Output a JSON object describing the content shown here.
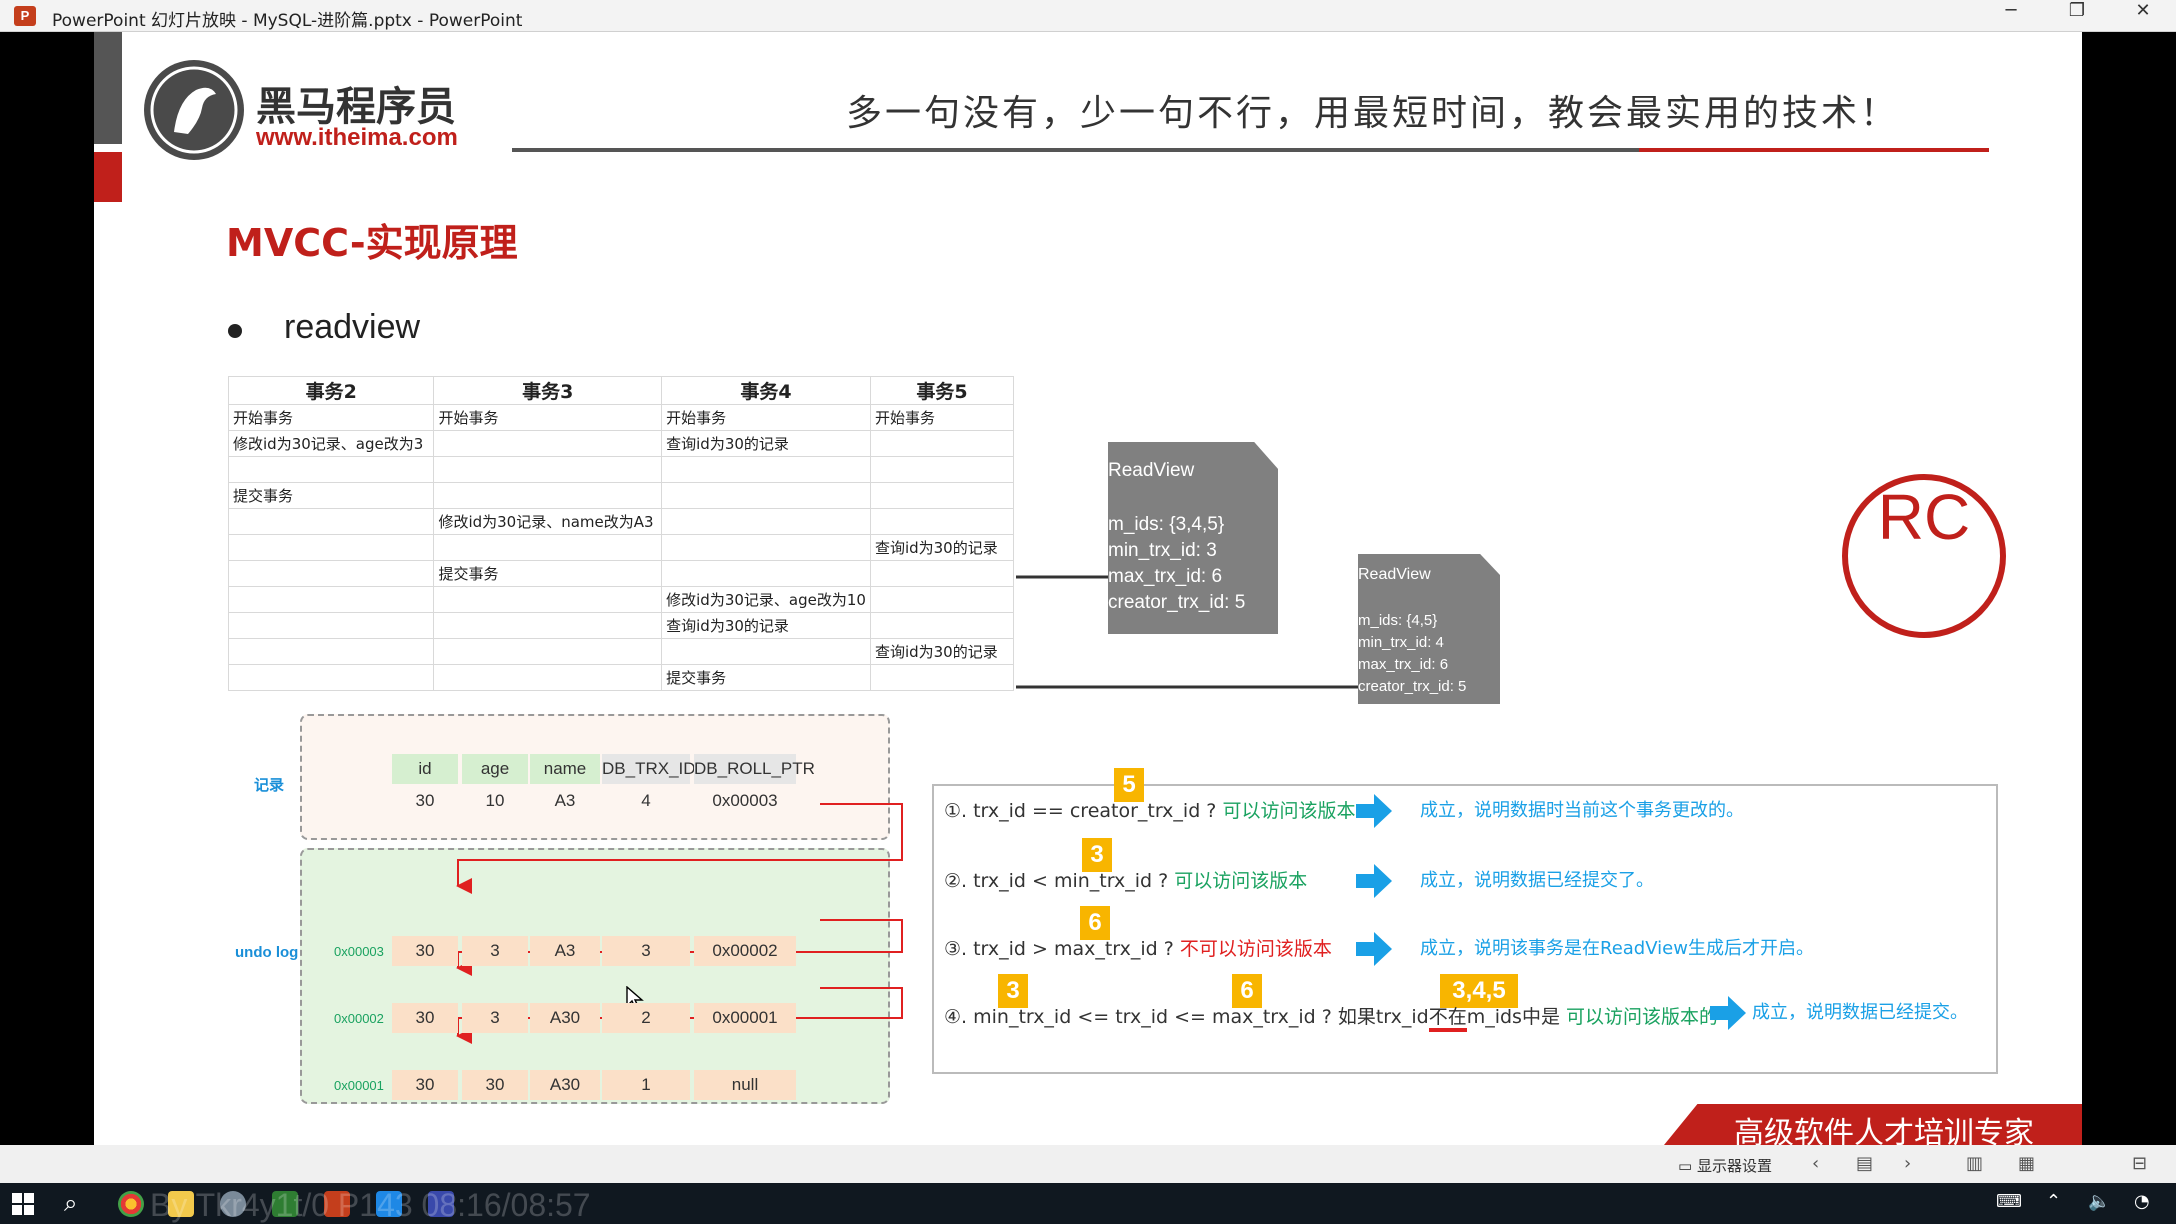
{
  "window": {
    "title": "PowerPoint 幻灯片放映  -  MySQL-进阶篇.pptx - PowerPoint",
    "app_icon": "P",
    "controls": {
      "minimize": "─",
      "restore": "❐",
      "close": "✕"
    }
  },
  "slide": {
    "logo": {
      "cn": "黑马程序员",
      "url": "www.itheima.com"
    },
    "slogan": "多一句没有，少一句不行，用最短时间，教会最实用的技术！",
    "title": "MVCC-实现原理",
    "bullet": "readview",
    "rc_label": "RC",
    "txn_table": {
      "headers": [
        "事务2",
        "事务3",
        "事务4",
        "事务5"
      ],
      "rows": [
        [
          "开始事务",
          "开始事务",
          "开始事务",
          "开始事务"
        ],
        [
          "修改id为30记录、age改为3",
          "",
          "查询id为30的记录",
          ""
        ],
        [
          "",
          "",
          "",
          ""
        ],
        [
          "提交事务",
          "",
          "",
          ""
        ],
        [
          "",
          "修改id为30记录、name改为A3",
          "",
          ""
        ],
        [
          "",
          "",
          "",
          "查询id为30的记录"
        ],
        [
          "",
          "提交事务",
          "",
          ""
        ],
        [
          "",
          "",
          "修改id为30记录、age改为10",
          ""
        ],
        [
          "",
          "",
          "查询id为30的记录",
          ""
        ],
        [
          "",
          "",
          "",
          "查询id为30的记录"
        ],
        [
          "",
          "",
          "提交事务",
          ""
        ]
      ]
    },
    "readview1": {
      "title": "ReadView",
      "lines": [
        "m_ids: {3,4,5}",
        "min_trx_id: 3",
        "max_trx_id: 6",
        "creator_trx_id: 5"
      ]
    },
    "readview2": {
      "title": "ReadView",
      "lines": [
        "m_ids: {4,5}",
        "min_trx_id: 4",
        "max_trx_id: 6",
        "creator_trx_id: 5"
      ]
    },
    "record_label": "记录",
    "undolog_label": "undo log",
    "record_table": {
      "headers": [
        "id",
        "age",
        "name",
        "DB_TRX_ID",
        "DB_ROLL_PTR"
      ],
      "row": [
        "30",
        "10",
        "A3",
        "4",
        "0x00003"
      ]
    },
    "undo_rows": [
      {
        "addr": "0x00003",
        "cells": [
          "30",
          "3",
          "A3",
          "3",
          "0x00002"
        ]
      },
      {
        "addr": "0x00002",
        "cells": [
          "30",
          "3",
          "A30",
          "2",
          "0x00001"
        ]
      },
      {
        "addr": "0x00001",
        "cells": [
          "30",
          "30",
          "A30",
          "1",
          "null"
        ]
      }
    ],
    "rules": [
      {
        "badge": "5",
        "text": "①. trx_id  == creator_trx_id ?",
        "verdict": "可以访问该版本",
        "result": "成立，说明数据时当前这个事务更改的。"
      },
      {
        "badge": "3",
        "text": "②. trx_id < min_trx_id ?",
        "verdict": "可以访问该版本",
        "result": "成立，说明数据已经提交了。"
      },
      {
        "badge": "6",
        "text": "③. trx_id > max_trx_id ?",
        "verdict": "不可以访问该版本",
        "result": "成立，说明该事务是在ReadView生成后才开启。"
      },
      {
        "badges": [
          "3",
          "6",
          "3,4,5"
        ],
        "text_a": "④. min_trx_id <= trx_id <= max_trx_id ? 如果trx_id",
        "text_b": "不在",
        "text_c": "m_ids中是",
        "verdict": "可以访问该版本的",
        "result": "成立，说明数据已经提交。"
      }
    ],
    "banner": "高级软件人才培训专家"
  },
  "statusbar": {
    "display_settings": "显示器设置"
  },
  "overlay_text": "By Tkr4y1t/0 P143 08:16/08:57",
  "colors": {
    "brand_red": "#c0201b",
    "green": "#1aa260",
    "blue": "#1aa0e6",
    "badge": "#f8b500"
  }
}
